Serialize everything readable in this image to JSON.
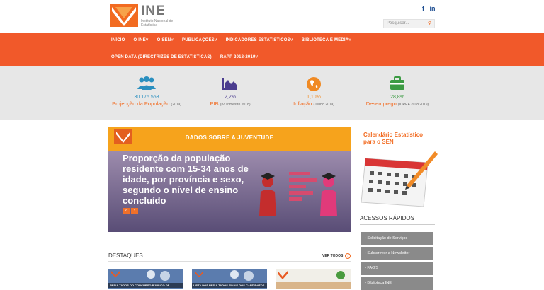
{
  "header": {
    "logo_text": "INE",
    "logo_sub": "Instituto Nacional de Estatística",
    "social": [
      "f",
      "in"
    ],
    "search_placeholder": "Pesquisar...",
    "search_icon": "search-icon"
  },
  "nav": {
    "row1": [
      "INÍCIO",
      "O INE",
      "O SEN",
      "PUBLICAÇÕES",
      "INDICADORES ESTATÍSTICOS",
      "BIBLIOTECA E MEDIA"
    ],
    "row2": [
      "OPEN DATA (DIRECTRIZES DE ESTATÍSTICAS)",
      "RAPP 2018-2019"
    ]
  },
  "stats": [
    {
      "value": "30 175 553",
      "label": "Projecção da População",
      "note": "(2019)",
      "icon": "population-icon",
      "color": "#2a8fbf"
    },
    {
      "value": "2,2%",
      "label": "PIB",
      "note": "(IV Trimestre 2018)",
      "icon": "chart-icon",
      "color": "#4b3d8f"
    },
    {
      "value": "1,10%",
      "label": "Inflação",
      "note": "(Junho 2019)",
      "icon": "globe-icon",
      "color": "#f08a24"
    },
    {
      "value": "28,8%",
      "label": "Desemprego",
      "note": "(IDREA 2018/2019)",
      "icon": "briefcase-icon",
      "color": "#3c9b43"
    }
  ],
  "banner": {
    "tag": "DADOS SOBRE A JUVENTUDE",
    "headline": "Proporção da população residente com 15-34 anos de idade, por província e sexo, segundo o nível de ensino concluído",
    "prev": "‹",
    "next": "›"
  },
  "sidebar": {
    "calendar_title_1": "Calendário Estatístico",
    "calendar_title_2": "para o SEN",
    "quick_title": "ACESSOS RÁPIDOS",
    "quick_links": [
      "Solicitação de Serviços",
      "Subscrever a Newsletter",
      "FAQ'S",
      "Biblioteca INE"
    ]
  },
  "destaques": {
    "title": "DESTAQUES",
    "ver_todos": "VER TODOS",
    "cards": [
      "RESULTADOS DO CONCURSO PÚBLICO DE",
      "LISTA DOS RESULTADOS FINAIS DOS CANDIDATOS",
      ""
    ]
  }
}
